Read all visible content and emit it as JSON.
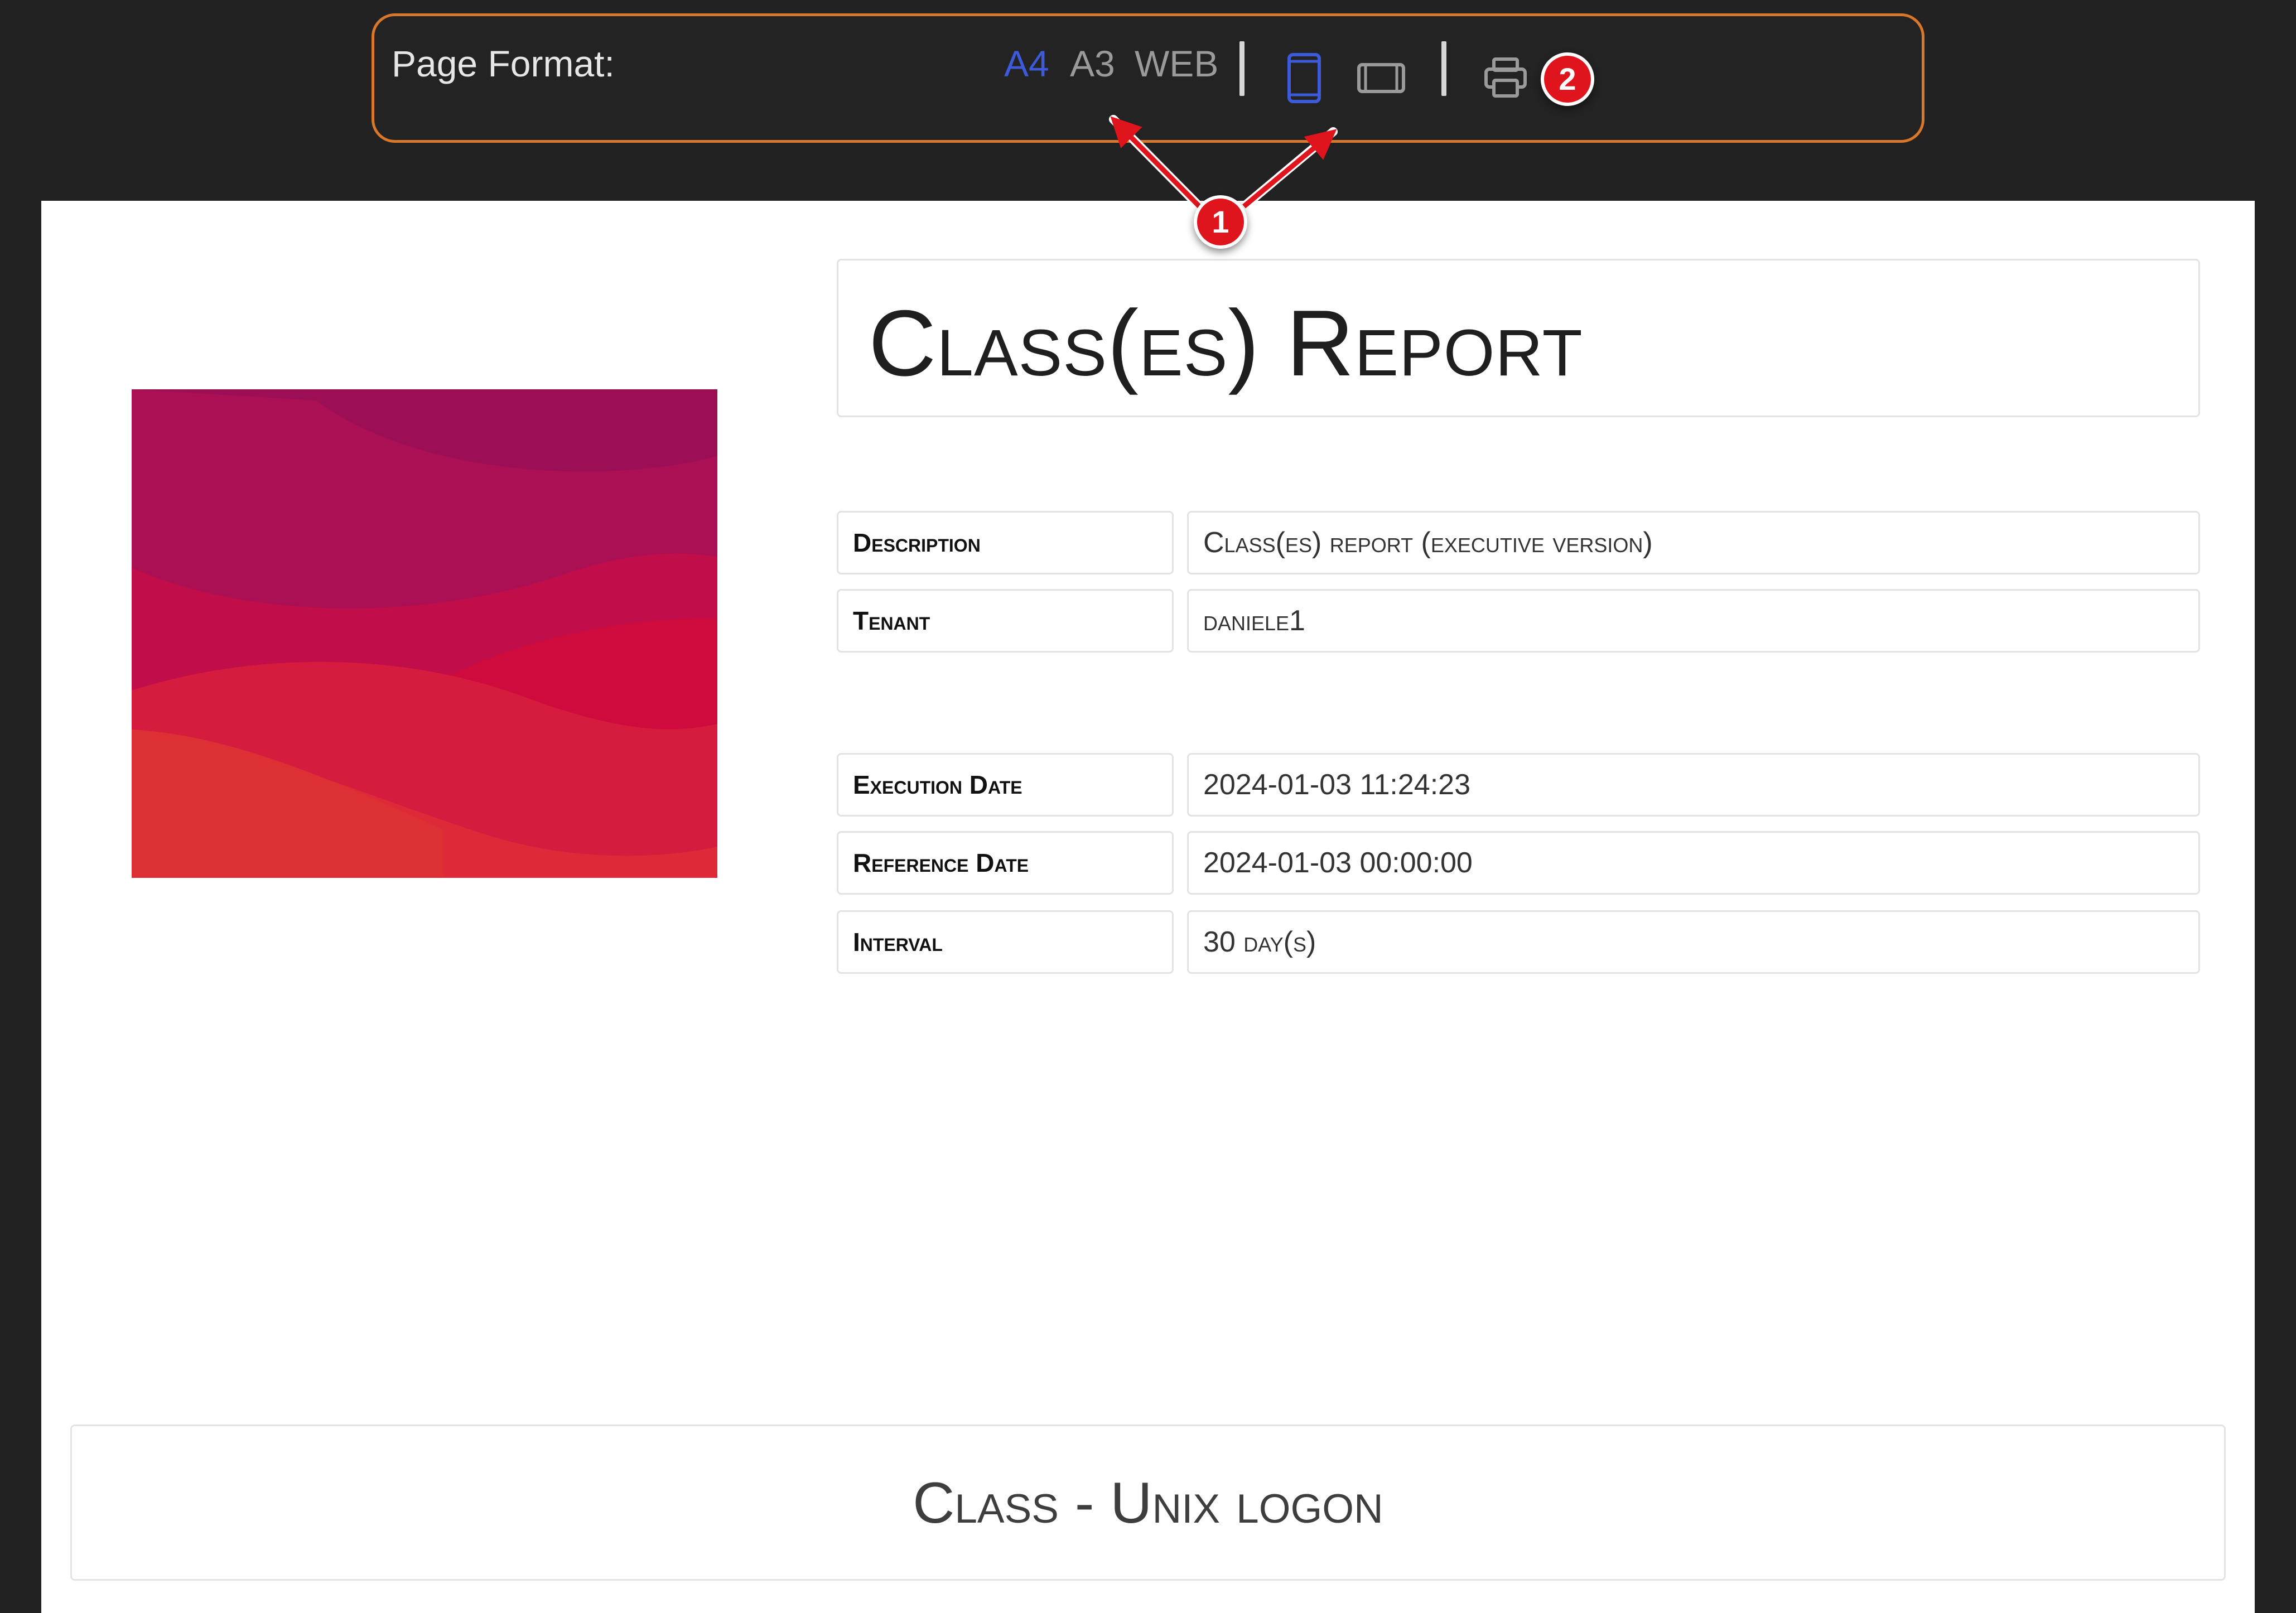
{
  "toolbar": {
    "label": "Page Format:",
    "formats": [
      "A4",
      "A3",
      "WEB"
    ],
    "active_format": "A4",
    "active_color": "#3d5adb",
    "icons": [
      "portrait-orientation-icon",
      "landscape-orientation-icon",
      "printer-icon"
    ]
  },
  "annotations": {
    "badge_1": "1",
    "badge_2": "2"
  },
  "report": {
    "title": "Class(es) Report",
    "fields": [
      {
        "key": "Description",
        "value": "Class(es) report (executive version)"
      },
      {
        "key": "Tenant",
        "value": "daniele1"
      },
      {
        "key": "Execution Date",
        "value": "2024-01-03 11:24:23"
      },
      {
        "key": "Reference Date",
        "value": "2024-01-03 00:00:00"
      },
      {
        "key": "Interval",
        "value": "30 day(s)"
      }
    ],
    "section_title": "Class - Unix logon"
  },
  "colors": {
    "toolbar_border": "#d9782a",
    "badge": "#e0141d",
    "background": "#222222"
  }
}
